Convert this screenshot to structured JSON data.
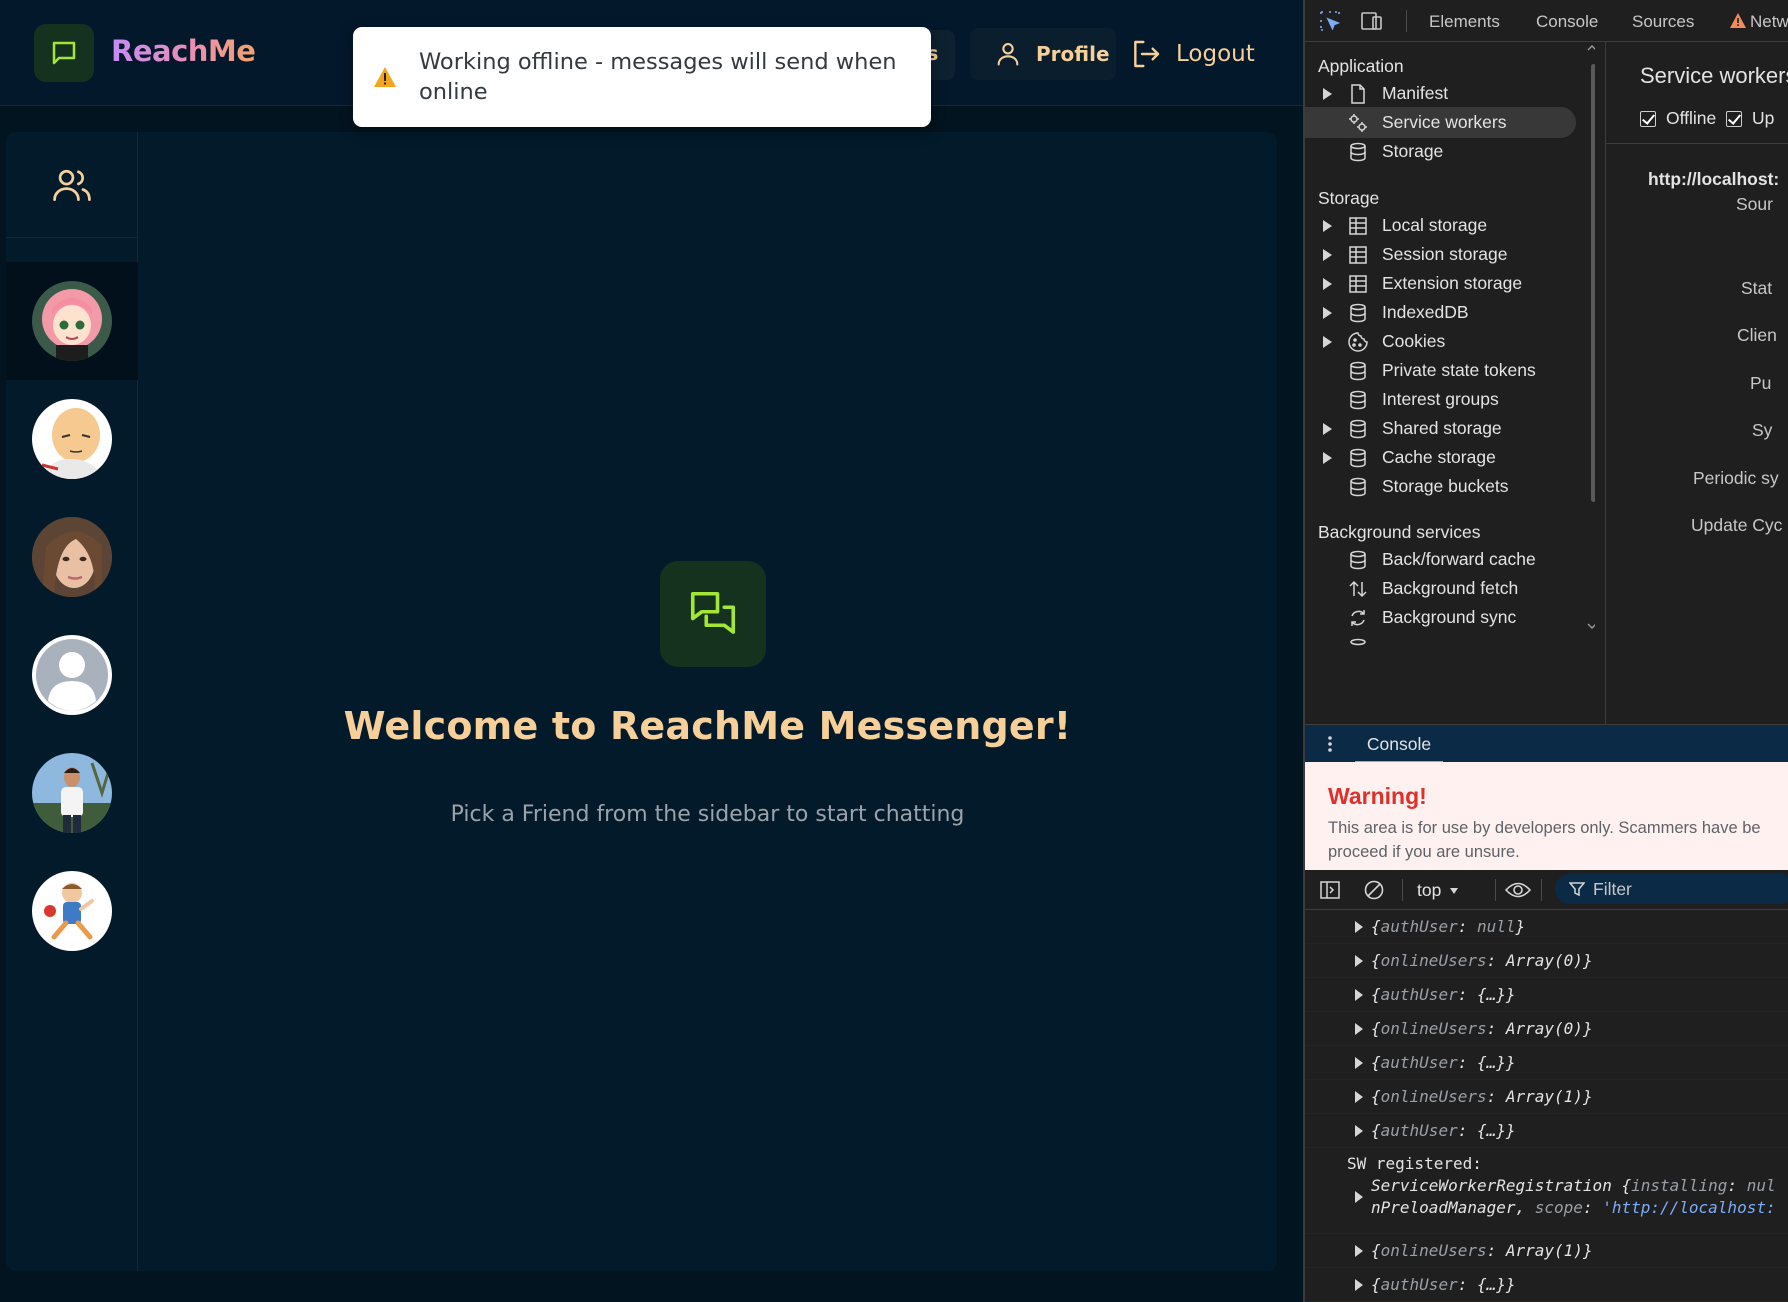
{
  "app": {
    "brand": "ReachMe",
    "nav_hidden_button_fragment": "s",
    "profile_label": "Profile",
    "logout_label": "Logout",
    "toast_message": "Working offline - messages will send when online",
    "sidebar_friends_icon": "users-icon",
    "friends": [
      {
        "avatar": "anime-girl-pink-hair",
        "active": true
      },
      {
        "avatar": "bald-cartoon-man",
        "active": false
      },
      {
        "avatar": "woman-portrait",
        "active": false
      },
      {
        "avatar": "default-user",
        "active": false
      },
      {
        "avatar": "man-outdoors",
        "active": false
      },
      {
        "avatar": "cartoon-child",
        "active": false
      }
    ],
    "welcome_title": "Welcome to ReachMe Messenger!",
    "welcome_subtitle": "Pick a Friend from the sidebar to start chatting",
    "colors": {
      "background": "#021420",
      "panel": "#031a2b",
      "accent_text": "#f6cf99",
      "icon_green": "#a3e635",
      "icon_box": "#15321f"
    }
  },
  "devtools": {
    "tabs": [
      "Elements",
      "Console",
      "Sources",
      "Netw"
    ],
    "tree": {
      "application_header": "Application",
      "application_items": [
        {
          "label": "Manifest",
          "expandable": true,
          "icon": "document-icon"
        },
        {
          "label": "Service workers",
          "expandable": false,
          "icon": "gears-icon",
          "selected": true
        },
        {
          "label": "Storage",
          "expandable": false,
          "icon": "database-icon"
        }
      ],
      "storage_header": "Storage",
      "storage_items": [
        {
          "label": "Local storage",
          "expandable": true,
          "icon": "table-icon"
        },
        {
          "label": "Session storage",
          "expandable": true,
          "icon": "table-icon"
        },
        {
          "label": "Extension storage",
          "expandable": true,
          "icon": "table-icon"
        },
        {
          "label": "IndexedDB",
          "expandable": true,
          "icon": "database-icon"
        },
        {
          "label": "Cookies",
          "expandable": true,
          "icon": "cookie-icon"
        },
        {
          "label": "Private state tokens",
          "expandable": false,
          "icon": "database-icon"
        },
        {
          "label": "Interest groups",
          "expandable": false,
          "icon": "database-icon"
        },
        {
          "label": "Shared storage",
          "expandable": true,
          "icon": "database-icon"
        },
        {
          "label": "Cache storage",
          "expandable": true,
          "icon": "database-icon"
        },
        {
          "label": "Storage buckets",
          "expandable": false,
          "icon": "database-icon"
        }
      ],
      "background_header": "Background services",
      "background_items": [
        {
          "label": "Back/forward cache",
          "icon": "database-icon"
        },
        {
          "label": "Background fetch",
          "icon": "up-down-arrows-icon"
        },
        {
          "label": "Background sync",
          "icon": "sync-icon"
        }
      ]
    },
    "service_workers": {
      "title": "Service workers",
      "offline_label": "Offline",
      "offline_checked": true,
      "update_label": "Up",
      "update_checked": true,
      "origin": "http://localhost:",
      "keys": [
        "Sour",
        "Stat",
        "Clien",
        "Pu",
        "Sy",
        "Periodic sy",
        "Update Cyc"
      ]
    },
    "drawer": {
      "tab_label": "Console"
    },
    "warning": {
      "title": "Warning!",
      "line1": "This area is for use by developers only. Scammers have be",
      "line2": "proceed if you are unsure."
    },
    "console_toolbar": {
      "context": "top",
      "filter_placeholder": "Filter"
    },
    "console_logs": [
      {
        "key": "authUser",
        "value": "null"
      },
      {
        "key": "onlineUsers",
        "value": "Array(0)"
      },
      {
        "key": "authUser",
        "value": "{…}"
      },
      {
        "key": "onlineUsers",
        "value": "Array(0)"
      },
      {
        "key": "authUser",
        "value": "{…}"
      },
      {
        "key": "onlineUsers",
        "value": "Array(1)"
      },
      {
        "key": "authUser",
        "value": "{…}"
      }
    ],
    "sw_registered": {
      "label": "SW registered:",
      "line1_class": "ServiceWorkerRegistration",
      "line1_key": "installing",
      "line1_val": "nul",
      "line2_prefix": "nPreloadManager,",
      "line2_key": "scope",
      "line2_val": "'http://localhost:"
    },
    "console_logs_after": [
      {
        "key": "onlineUsers",
        "value": "Array(1)"
      },
      {
        "key": "authUser",
        "value": "{…}"
      }
    ]
  }
}
